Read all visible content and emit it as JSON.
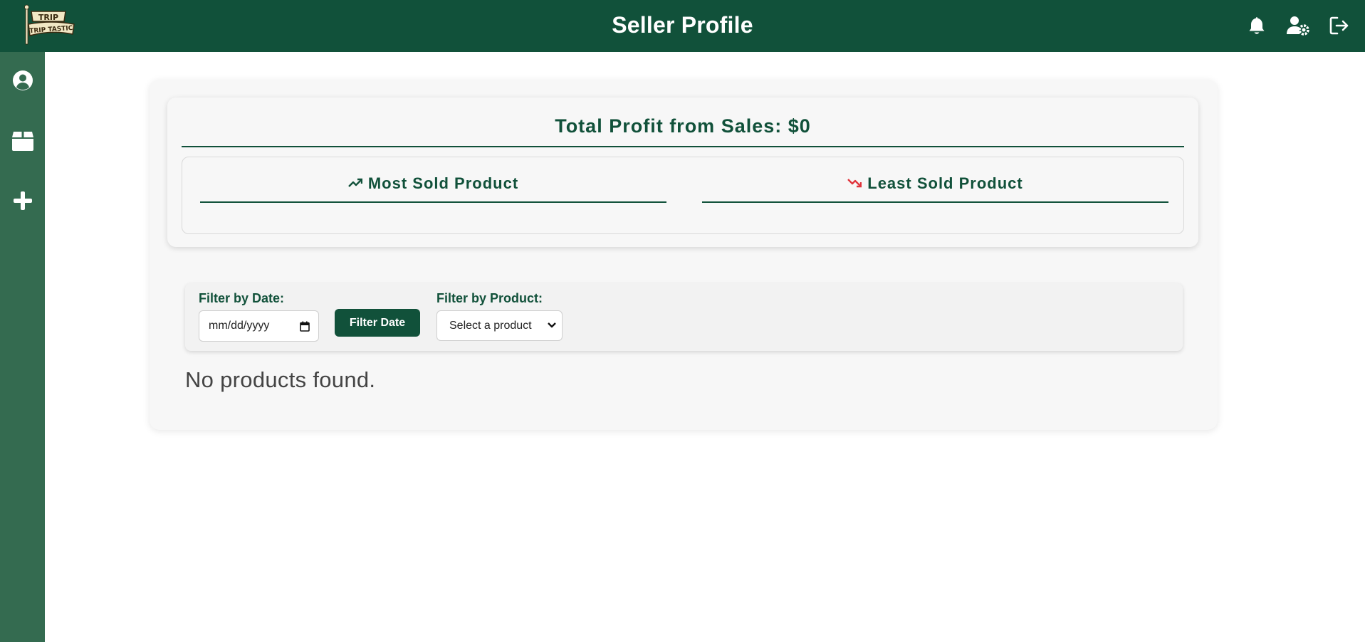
{
  "header": {
    "title": "Seller Profile",
    "logo": {
      "top_text": "TRIP",
      "bottom_text": "TRIP TASTIC"
    },
    "actions": [
      {
        "icon": "bell-icon"
      },
      {
        "icon": "user-settings-icon"
      },
      {
        "icon": "logout-icon"
      }
    ]
  },
  "sidebar": {
    "items": [
      {
        "icon": "user-circle-icon"
      },
      {
        "icon": "box-icon"
      },
      {
        "icon": "plus-icon"
      }
    ]
  },
  "stats": {
    "profit_title": "Total Profit from Sales: $0",
    "most_sold_label": "Most Sold Product",
    "least_sold_label": "Least Sold Product"
  },
  "filters": {
    "date_label": "Filter by Date:",
    "date_placeholder": "mm/dd/yyyy",
    "filter_button": "Filter Date",
    "product_label": "Filter by Product:",
    "product_selected": "Select a product"
  },
  "empty_message": "No products found.",
  "colors": {
    "primary": "#11513a",
    "sidebar": "#346b50",
    "trend_down": "#e0343c"
  }
}
